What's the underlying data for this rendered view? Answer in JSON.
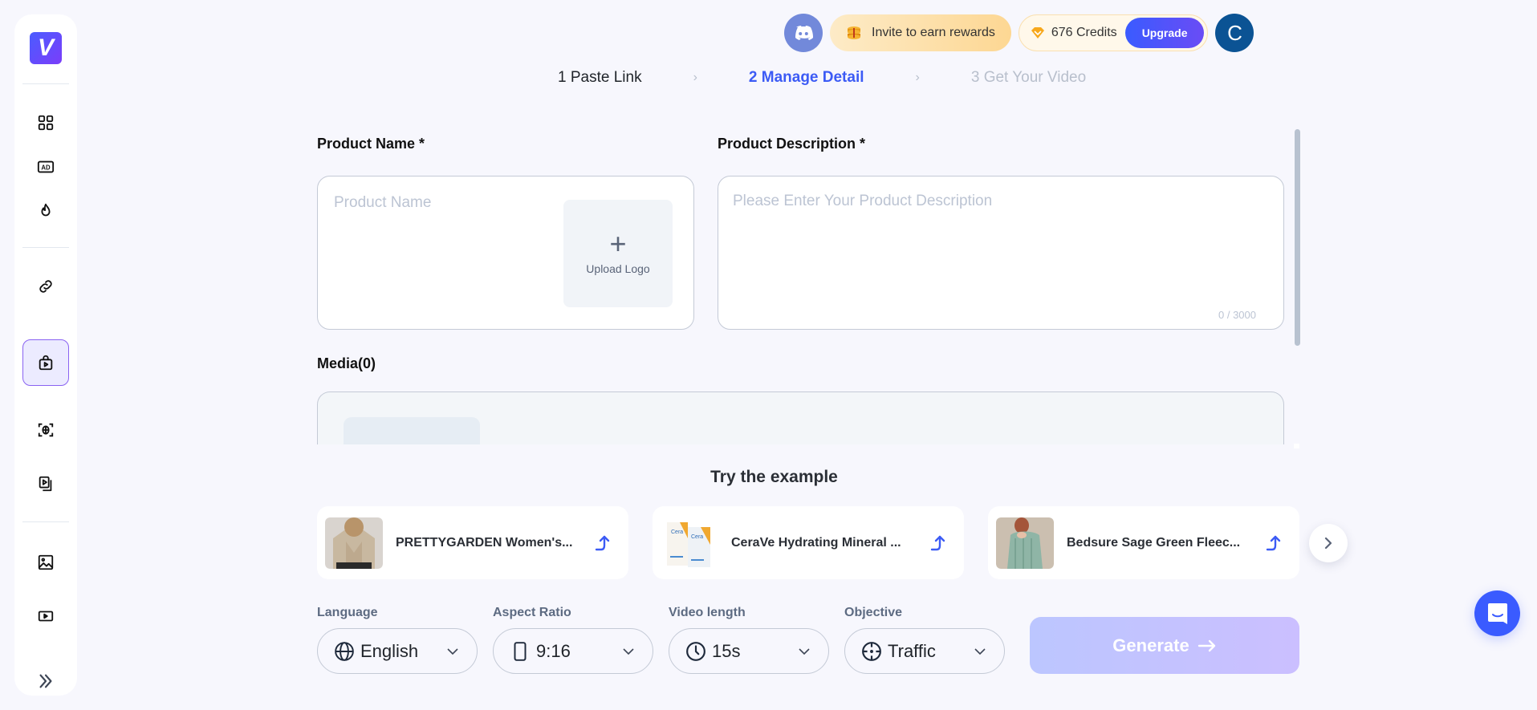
{
  "sidebar": {
    "logo_letter": "V",
    "items": [
      {
        "name": "dashboard",
        "icon": "grid-icon"
      },
      {
        "name": "ads",
        "icon": "ad-icon"
      },
      {
        "name": "trending",
        "icon": "flame-icon"
      },
      {
        "name": "link-to-video",
        "icon": "link-icon"
      },
      {
        "name": "product-video",
        "icon": "shopping-bag-play-icon",
        "active": true
      },
      {
        "name": "avatar-scan",
        "icon": "face-scan-icon"
      },
      {
        "name": "video-batch",
        "icon": "video-copy-icon"
      },
      {
        "name": "image",
        "icon": "image-icon"
      },
      {
        "name": "video",
        "icon": "video-play-icon"
      }
    ],
    "expand_icon": "double-chevron-right-icon"
  },
  "topbar": {
    "discord_icon": "discord-icon",
    "invite_label": "Invite to earn rewards",
    "credits_label": "676 Credits",
    "upgrade_label": "Upgrade",
    "avatar_letter": "C"
  },
  "steps": [
    {
      "label": "1 Paste Link",
      "state": "done"
    },
    {
      "label": "2 Manage Detail",
      "state": "active"
    },
    {
      "label": "3 Get Your Video",
      "state": "pending"
    }
  ],
  "form": {
    "product_name_label": "Product Name *",
    "product_name_placeholder": "Product Name",
    "product_name_value": "",
    "upload_logo_label": "Upload Logo",
    "product_desc_label": "Product Description *",
    "product_desc_placeholder": "Please Enter Your Product Description",
    "product_desc_value": "",
    "char_count": "0 / 3000",
    "media_label": "Media(0)"
  },
  "examples": {
    "title": "Try the example",
    "items": [
      {
        "name": "PRETTYGARDEN Women's..."
      },
      {
        "name": "CeraVe Hydrating Mineral ..."
      },
      {
        "name": "Bedsure Sage Green Fleec..."
      }
    ]
  },
  "settings": {
    "language": {
      "label": "Language",
      "value": "English"
    },
    "aspect_ratio": {
      "label": "Aspect Ratio",
      "value": "9:16"
    },
    "video_length": {
      "label": "Video length",
      "value": "15s"
    },
    "objective": {
      "label": "Objective",
      "value": "Traffic"
    }
  },
  "generate_label": "Generate",
  "colors": {
    "accent": "#3c5bf5",
    "upgrade_gradient_start": "#3a5bff",
    "upgrade_gradient_end": "#6a4cf5",
    "avatar_bg": "#0b5394",
    "discord": "#7289da"
  }
}
